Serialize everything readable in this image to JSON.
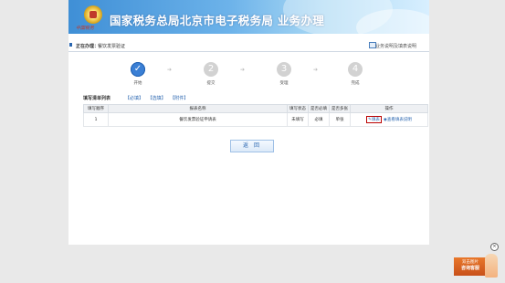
{
  "header": {
    "brand": "中国税务",
    "title": "国家税务总局北京市电子税务局 业务办理"
  },
  "breadcrumb": {
    "label": "正在办理：",
    "current": "餐饮发票验证",
    "help": "业务说明及填表说明"
  },
  "steps": [
    {
      "number": "✓",
      "label": "开始",
      "state": "done"
    },
    {
      "number": "2",
      "label": "提交",
      "state": "pending"
    },
    {
      "number": "3",
      "label": "受理",
      "state": "pending"
    },
    {
      "number": "4",
      "label": "完成",
      "state": "pending"
    }
  ],
  "list": {
    "title": "填写清单列表",
    "links": [
      "【必填】",
      "【选填】",
      "【附件】"
    ]
  },
  "table": {
    "headers": [
      "填写顺序",
      "报表名称",
      "填写状态",
      "是否必填",
      "是否多张",
      "操作"
    ],
    "rows": [
      {
        "order": "1",
        "name": "餐饮发票验证申请表",
        "status": "未填写",
        "required": "必填",
        "multiple": "单张",
        "fill_label": "填表",
        "view_label": "查看填表说明"
      }
    ]
  },
  "back_label": "返 回",
  "float_widget": {
    "line1": "双击图片",
    "line2": "咨询客服",
    "close": "×"
  },
  "colors": {
    "accent": "#3a7fd5",
    "link": "#2a66b0",
    "highlight": "#bb0000"
  }
}
